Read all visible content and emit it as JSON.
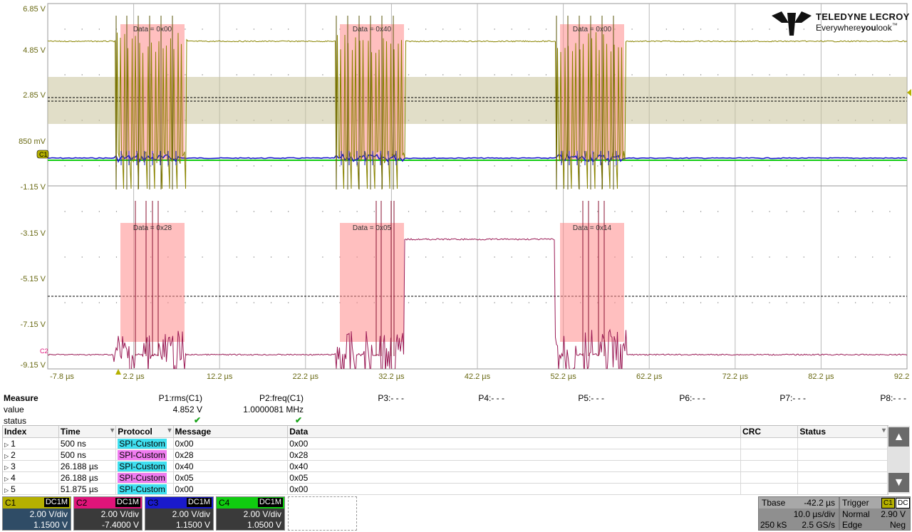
{
  "brand": {
    "name": "TELEDYNE LECROY",
    "tagline_a": "Everywhere",
    "tagline_b": "you",
    "tagline_c": "look",
    "tm": "™"
  },
  "y_axis_labels": [
    "6.85 V",
    "4.85 V",
    "2.85 V",
    "850 mV",
    "-1.15 V",
    "-3.15 V",
    "-5.15 V",
    "-7.15 V",
    "-9.15 V"
  ],
  "x_axis_labels": [
    "-7.8 µs",
    "2.2 µs",
    "12.2 µs",
    "22.2 µs",
    "32.2 µs",
    "42.2 µs",
    "52.2 µs",
    "62.2 µs",
    "72.2 µs",
    "82.2 µs",
    "92.2 µs"
  ],
  "markers": {
    "c1": "C1",
    "c2": "C2"
  },
  "decode_labels_top": [
    "Data = 0x00",
    "Data = 0x40",
    "Data = 0x00"
  ],
  "decode_labels_bottom": [
    "Data = 0x28",
    "Data = 0x05",
    "Data = 0x14"
  ],
  "colors": {
    "c1": "#b5b000",
    "c1_trace": "#8a8400",
    "c2": "#e0147a",
    "c2_trace": "#9a1a55",
    "c3": "#1a1acc",
    "c4": "#10cc10",
    "decode": "#ff8a8a",
    "cyan": "#3fe0f0",
    "pink": "#f07cf0"
  },
  "measure": {
    "title": "Measure",
    "row_value": "value",
    "row_status": "status",
    "params": [
      {
        "name": "P1:rms(C1)",
        "value": "4.852 V",
        "status": "✔"
      },
      {
        "name": "P2:freq(C1)",
        "value": "1.0000081 MHz",
        "status": "✔"
      },
      {
        "name": "P3:- - -",
        "value": "",
        "status": ""
      },
      {
        "name": "P4:- - -",
        "value": "",
        "status": ""
      },
      {
        "name": "P5:- - -",
        "value": "",
        "status": ""
      },
      {
        "name": "P6:- - -",
        "value": "",
        "status": ""
      },
      {
        "name": "P7:- - -",
        "value": "",
        "status": ""
      },
      {
        "name": "P8:- - -",
        "value": "",
        "status": ""
      }
    ]
  },
  "decode_table": {
    "columns": [
      "Index",
      "Time",
      "Protocol",
      "Message",
      "Data",
      "CRC",
      "Status"
    ],
    "rows": [
      {
        "index": "1",
        "time": "500 ns",
        "protocol": "SPI-Custom",
        "message": "0x00",
        "data": "0x00",
        "color": "cyan"
      },
      {
        "index": "2",
        "time": "500 ns",
        "protocol": "SPI-Custom",
        "message": "0x28",
        "data": "0x28",
        "color": "pink"
      },
      {
        "index": "3",
        "time": "26.188 µs",
        "protocol": "SPI-Custom",
        "message": "0x40",
        "data": "0x40",
        "color": "cyan"
      },
      {
        "index": "4",
        "time": "26.188 µs",
        "protocol": "SPI-Custom",
        "message": "0x05",
        "data": "0x05",
        "color": "pink"
      },
      {
        "index": "5",
        "time": "51.875 µs",
        "protocol": "SPI-Custom",
        "message": "0x00",
        "data": "0x00",
        "color": "cyan"
      }
    ]
  },
  "channels": [
    {
      "name": "C1",
      "coupling": "DC1M",
      "vdiv": "2.00 V/div",
      "offset": "1.1500 V"
    },
    {
      "name": "C2",
      "coupling": "DC1M",
      "vdiv": "2.00 V/div",
      "offset": "-7.4000 V"
    },
    {
      "name": "C3",
      "coupling": "DC1M",
      "vdiv": "2.00 V/div",
      "offset": "1.1500 V"
    },
    {
      "name": "C4",
      "coupling": "DC1M",
      "vdiv": "2.00 V/div",
      "offset": "1.0500 V"
    }
  ],
  "timebase": {
    "label": "Tbase",
    "delay": "-42.2 µs",
    "per_div": "10.0 µs/div",
    "samples": "250 kS",
    "rate": "2.5 GS/s"
  },
  "trigger": {
    "label": "Trigger",
    "badge_ch": "C1",
    "badge_cp": "DC",
    "mode": "Normal",
    "level": "2.90 V",
    "type": "Edge",
    "slope": "Neg"
  }
}
